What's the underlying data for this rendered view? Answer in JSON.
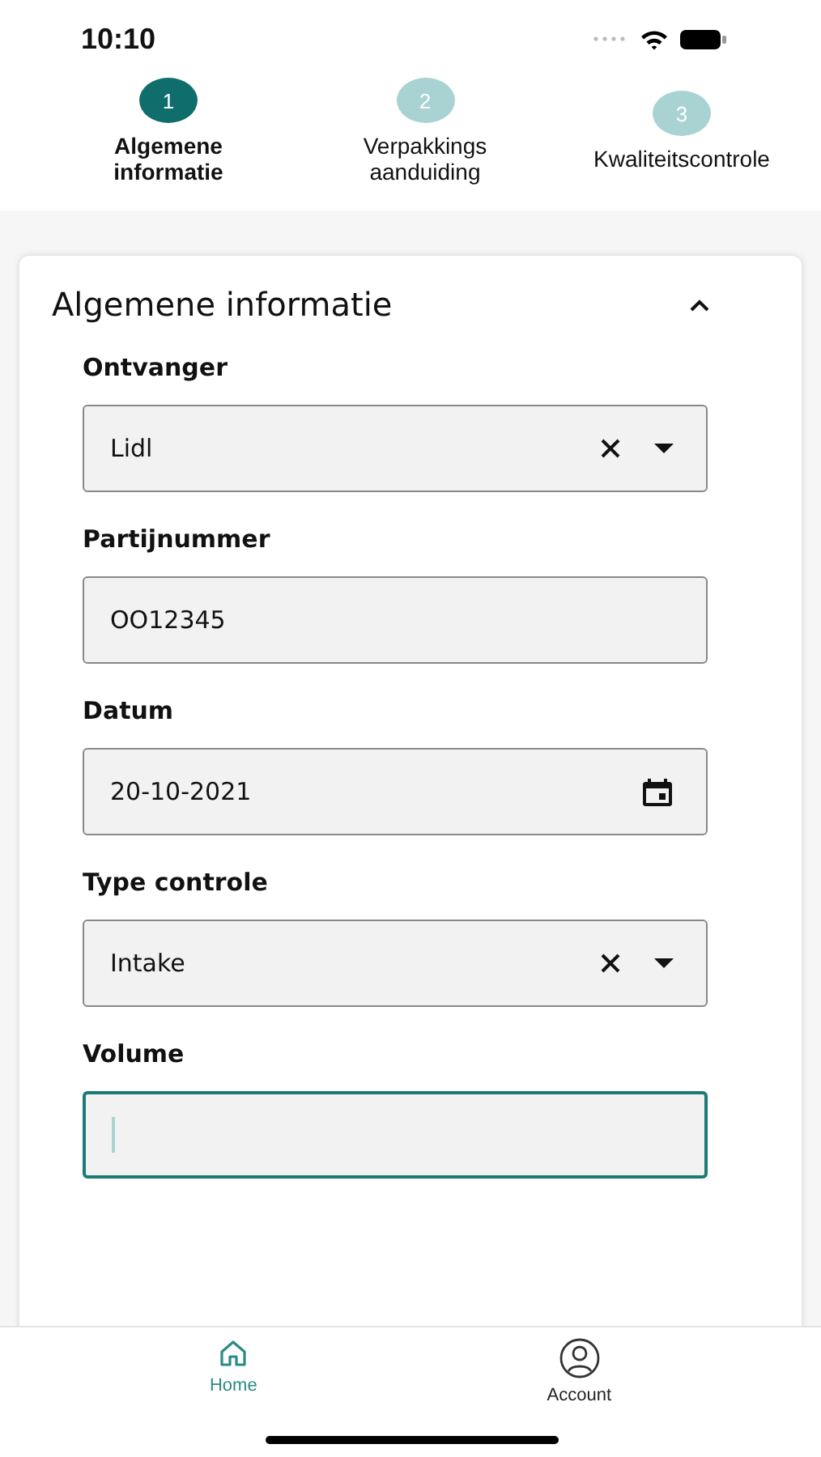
{
  "status_bar": {
    "time": "10:10"
  },
  "steps": [
    {
      "number": "1",
      "label": "Algemene informatie",
      "selected": true
    },
    {
      "number": "2",
      "label": "Verpakkings aanduiding",
      "selected": false
    },
    {
      "number": "3",
      "label": "Kwaliteitscontrole",
      "selected": false
    }
  ],
  "section": {
    "title": "Algemene informatie",
    "expanded": true
  },
  "fields": [
    {
      "label": "Ontvanger",
      "kind": "select",
      "value": "Lidl",
      "focused": false
    },
    {
      "label": "Partijnummer",
      "kind": "text",
      "value": "OO12345",
      "focused": false
    },
    {
      "label": "Datum",
      "kind": "date",
      "value": "20-10-2021",
      "focused": false
    },
    {
      "label": "Type controle",
      "kind": "select",
      "value": "Intake",
      "focused": false
    },
    {
      "label": "Volume",
      "kind": "text",
      "focused": true
    }
  ],
  "tab_bar": [
    {
      "label": "Home",
      "kind": "home",
      "selected": true
    },
    {
      "label": "Account",
      "kind": "account",
      "selected": false
    }
  ]
}
